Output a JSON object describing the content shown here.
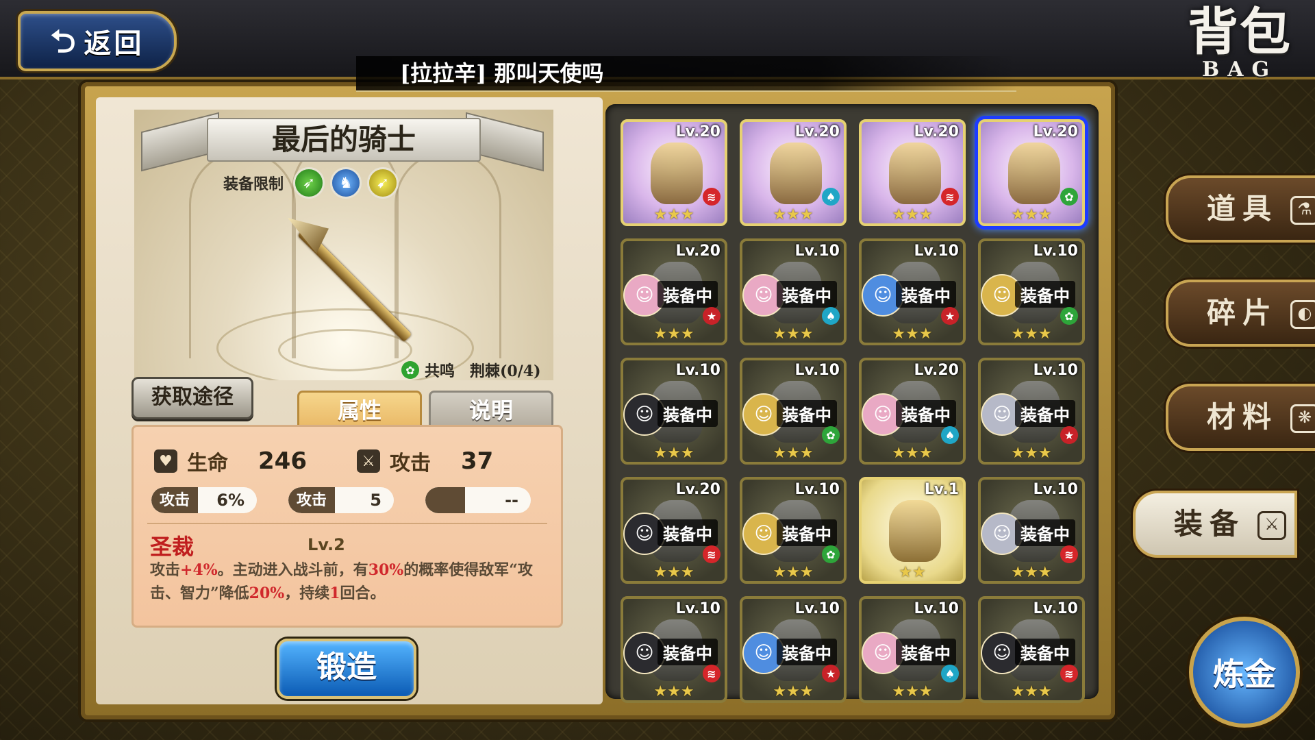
{
  "header": {
    "back_label": "返回",
    "title_cn": "背包",
    "title_en": "BAG",
    "item_name": "[拉拉辛] 那叫天使吗"
  },
  "detail": {
    "equip_name": "最后的骑士",
    "restriction_label": "装备限制",
    "class_icons": [
      "spear-class-icon",
      "horse-class-icon",
      "wing-class-icon"
    ],
    "resonance_label": "共鸣",
    "resonance_value": "荆棘(0/4)",
    "acquire_label": "获取途径",
    "tabs": [
      {
        "label": "属性",
        "active": true
      },
      {
        "label": "说明",
        "active": false
      }
    ],
    "stats": {
      "hp_label": "生命",
      "hp_value": "246",
      "atk_label": "攻击",
      "atk_value": "37"
    },
    "sub_stats": [
      {
        "key": "攻击",
        "value": "6%"
      },
      {
        "key": "攻击",
        "value": "5"
      },
      {
        "key": "",
        "value": "--"
      }
    ],
    "skill": {
      "name": "圣裁",
      "level": "Lv.2",
      "desc_parts": [
        {
          "t": "攻击",
          "hl": false
        },
        {
          "t": "+4%",
          "hl": true
        },
        {
          "t": "。主动进入战斗前，有",
          "hl": false
        },
        {
          "t": "30%",
          "hl": true
        },
        {
          "t": "的概率使得敌军“攻击、智力”降低",
          "hl": false
        },
        {
          "t": "20%",
          "hl": true
        },
        {
          "t": "，持续",
          "hl": false
        },
        {
          "t": "1",
          "hl": true
        },
        {
          "t": "回合。",
          "hl": false
        }
      ]
    },
    "forge_label": "锻造"
  },
  "equipped_label": "装备中",
  "inventory": [
    {
      "lv": "Lv.20",
      "style": "bright",
      "elem": "red",
      "stars": 3,
      "avatar": ""
    },
    {
      "lv": "Lv.20",
      "style": "bright",
      "elem": "cyan",
      "stars": 3,
      "avatar": ""
    },
    {
      "lv": "Lv.20",
      "style": "bright",
      "elem": "red",
      "stars": 3,
      "avatar": ""
    },
    {
      "lv": "Lv.20",
      "style": "bright",
      "elem": "green",
      "stars": 3,
      "avatar": "",
      "selected": true
    },
    {
      "lv": "Lv.20",
      "style": "dark",
      "elem": "redstar",
      "stars": 3,
      "avatar": "pink"
    },
    {
      "lv": "Lv.10",
      "style": "dark",
      "elem": "cyan",
      "stars": 3,
      "avatar": "pink"
    },
    {
      "lv": "Lv.10",
      "style": "dark",
      "elem": "redstar",
      "stars": 3,
      "avatar": "blue"
    },
    {
      "lv": "Lv.10",
      "style": "dark",
      "elem": "green",
      "stars": 3,
      "avatar": "blond"
    },
    {
      "lv": "Lv.10",
      "style": "dark",
      "elem": "",
      "stars": 3,
      "avatar": "dark"
    },
    {
      "lv": "Lv.10",
      "style": "dark",
      "elem": "green",
      "stars": 3,
      "avatar": "blond"
    },
    {
      "lv": "Lv.20",
      "style": "dark",
      "elem": "cyan",
      "stars": 3,
      "avatar": "pink"
    },
    {
      "lv": "Lv.10",
      "style": "dark",
      "elem": "redstar",
      "stars": 3,
      "avatar": "silver"
    },
    {
      "lv": "Lv.20",
      "style": "dark",
      "elem": "red",
      "stars": 3,
      "avatar": "dark"
    },
    {
      "lv": "Lv.10",
      "style": "dark",
      "elem": "green",
      "stars": 3,
      "avatar": "blond"
    },
    {
      "lv": "Lv.1",
      "style": "gold",
      "elem": "",
      "stars": 2,
      "avatar": ""
    },
    {
      "lv": "Lv.10",
      "style": "dark",
      "elem": "red",
      "stars": 3,
      "avatar": "silver"
    },
    {
      "lv": "Lv.10",
      "style": "dark",
      "elem": "red",
      "stars": 3,
      "avatar": "dark"
    },
    {
      "lv": "Lv.10",
      "style": "dark",
      "elem": "redstar",
      "stars": 3,
      "avatar": "blue"
    },
    {
      "lv": "Lv.10",
      "style": "dark",
      "elem": "cyan",
      "stars": 3,
      "avatar": "pink"
    },
    {
      "lv": "Lv.10",
      "style": "dark",
      "elem": "red",
      "stars": 3,
      "avatar": "dark"
    }
  ],
  "side_tabs": [
    {
      "label": "道具",
      "icon": "potion-icon",
      "glyph": "⚗",
      "active": false
    },
    {
      "label": "碎片",
      "icon": "shard-icon",
      "glyph": "◐",
      "active": false
    },
    {
      "label": "材料",
      "icon": "material-icon",
      "glyph": "❋",
      "active": false
    },
    {
      "label": "装备",
      "icon": "equipment-icon",
      "glyph": "⚔",
      "active": true
    }
  ],
  "alchemy_label": "炼金",
  "colors": {
    "avatar_pink": "#e9a9c4",
    "avatar_blue": "#4f8de0",
    "avatar_blond": "#d9b54c",
    "avatar_dark": "#2b2b2f",
    "avatar_silver": "#b6b9c8"
  }
}
